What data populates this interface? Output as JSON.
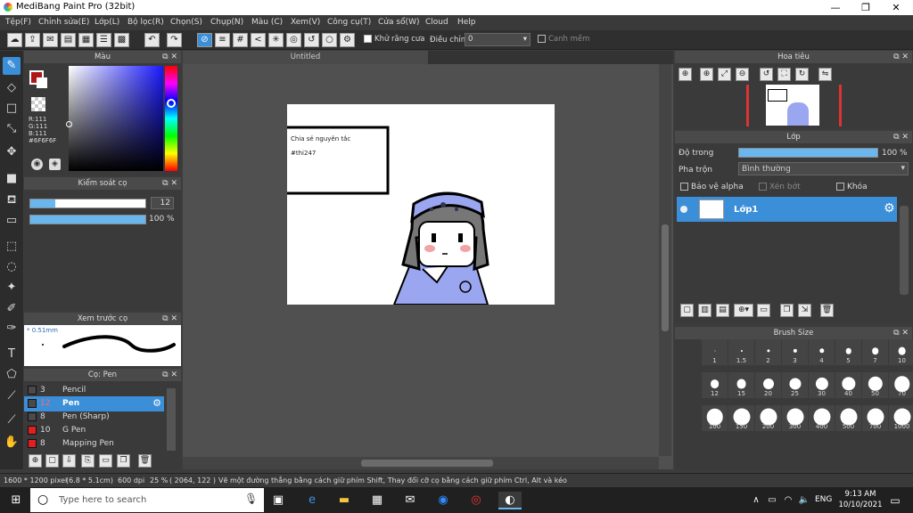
{
  "window": {
    "title": "MediBang Paint Pro (32bit)",
    "min": "—",
    "max": "❐",
    "close": "✕"
  },
  "menu": [
    "Tệp(F)",
    "Chỉnh sửa(E)",
    "Lớp(L)",
    "Bộ lọc(R)",
    "Chọn(S)",
    "Chụp(N)",
    "Màu (C)",
    "Xem(V)",
    "Công cụ(T)",
    "Cửa sổ(W)",
    "Cloud",
    "Help"
  ],
  "toolbar": {
    "antialias_label": "Khử răng cưa",
    "adjust_label": "Điều chỉnh",
    "adjust_value": "0",
    "snap_label": "Canh mềm"
  },
  "color_panel": {
    "title": "Màu",
    "r": "R:111",
    "g": "G:111",
    "b": "B:111",
    "hex": "#6F6F6F",
    "fg_color": "#b01818"
  },
  "brush_control": {
    "title": "Kiểm soát cọ",
    "size": "12",
    "opacity": "100 %",
    "size_fraction": 0.22,
    "opacity_fraction": 1.0
  },
  "brush_preview": {
    "title": "Xem trước cọ",
    "size_label": "* 0.51mm"
  },
  "brush_panel": {
    "title": "Cọ: Pen",
    "items": [
      {
        "num": "3",
        "label": "Pencil",
        "color": "#4a4a4a",
        "selected": false
      },
      {
        "num": "12",
        "label": "Pen",
        "color": "#4a4a4a",
        "selected": true
      },
      {
        "num": "8",
        "label": "Pen (Sharp)",
        "color": "#4a4a4a",
        "selected": false
      },
      {
        "num": "10",
        "label": "G Pen",
        "color": "#e02020",
        "selected": false
      },
      {
        "num": "8",
        "label": "Mapping Pen",
        "color": "#e02020",
        "selected": false
      }
    ]
  },
  "canvas": {
    "tab_title": "Untitled",
    "note_line1": "Chia sẻ nguyên tắc",
    "note_line2": "#thi247"
  },
  "navigator": {
    "title": "Hoa tiêu"
  },
  "layers": {
    "title": "Lớp",
    "opacity_label": "Độ trong",
    "opacity_value": "100 %",
    "blend_label": "Pha trộn",
    "blend_value": "Bình thường",
    "protect_alpha": "Bảo vệ alpha",
    "clipping": "Xén bớt",
    "lock": "Khóa",
    "layer_name": "Lớp1"
  },
  "brush_size": {
    "title": "Brush Size",
    "sizes": [
      "1",
      "1.5",
      "2",
      "3",
      "4",
      "5",
      "7",
      "10",
      "12",
      "15",
      "20",
      "25",
      "30",
      "40",
      "50",
      "70",
      "100",
      "150",
      "200",
      "300",
      "400",
      "500",
      "700",
      "1000"
    ]
  },
  "status": {
    "dims": "1600 * 1200 pixel",
    "size_cm": "(6.8 * 5.1cm)",
    "dpi": "600 dpi",
    "zoom": "25 %",
    "coords": "( 2064, 122 )",
    "hint": "Vẽ một đường thẳng bằng cách giữ phím Shift, Thay đổi cỡ cọ bằng cách giữ phím Ctrl, Alt và kéo"
  },
  "taskbar": {
    "search_placeholder": "Type here to search",
    "lang": "ENG",
    "time": "9:13 AM",
    "date": "10/10/2021"
  }
}
